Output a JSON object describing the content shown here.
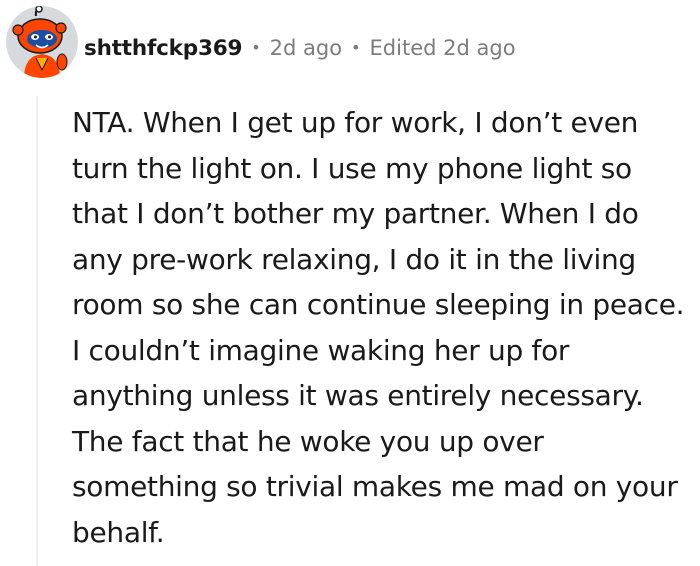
{
  "comment": {
    "author": "shtthfckp369",
    "separator": "•",
    "posted": "2d ago",
    "edited": "Edited 2d ago",
    "lines": [
      "NTA. When I get up for work, I don’t even",
      "turn the light on. I use my phone light so",
      "that I don’t bother my partner. When I do",
      "any pre-work relaxing, I do it in the living",
      "room so she can continue sleeping in peace.",
      "I couldn’t imagine waking her up for",
      "anything unless it was entirely necessary.",
      "The fact that he woke you up over",
      "something so trivial makes me mad on your",
      "behalf."
    ]
  },
  "colors": {
    "avatar_bg": "#d7dadc",
    "snoo_body": "#ff4500",
    "meta_text": "#7c7c7c",
    "thread_line": "#edeff1"
  },
  "icons": {
    "avatar": "reddit-snoo-avatar-icon"
  }
}
